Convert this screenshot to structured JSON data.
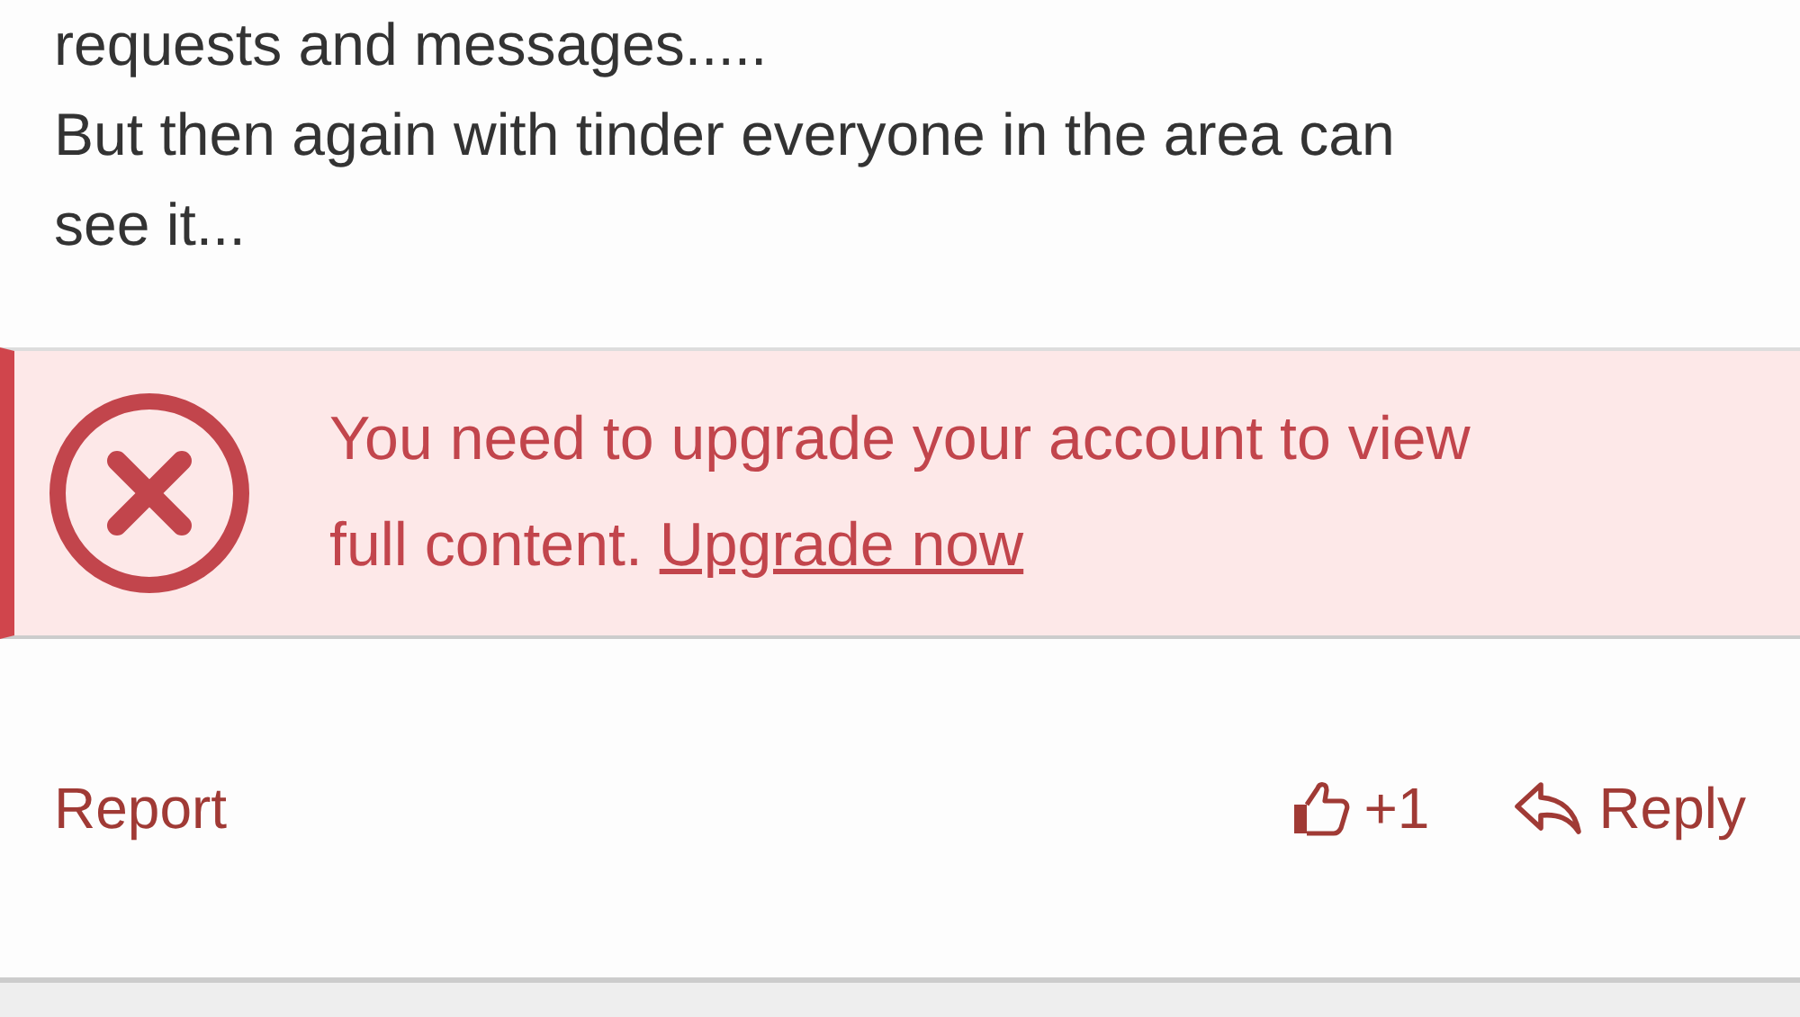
{
  "post": {
    "lines": [
      "requests and messages.....",
      "But then again with tinder everyone in the area can",
      "see it..."
    ]
  },
  "alert": {
    "message": "You need to upgrade your account to view full content.",
    "link": "Upgrade now"
  },
  "actions": {
    "report": "Report",
    "like_count": "+1",
    "reply": "Reply"
  }
}
